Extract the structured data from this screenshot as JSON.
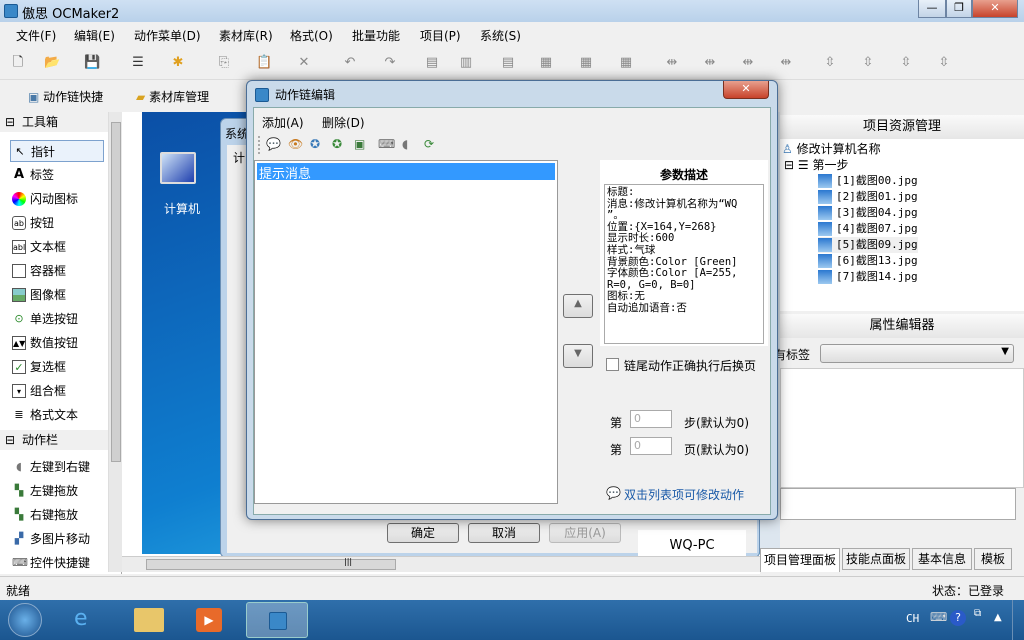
{
  "app": {
    "title": "傲思 OCMaker2"
  },
  "menu": [
    "文件(F)",
    "编辑(E)",
    "动作菜单(D)",
    "素材库(R)",
    "格式(O)",
    "批量功能",
    "项目(P)",
    "系统(S)"
  ],
  "quickbar": {
    "action_chain": "动作链快捷",
    "library": "素材库管理"
  },
  "toolbox": {
    "header": "工具箱",
    "items": [
      "指针",
      "标签",
      "闪动图标",
      "按钮",
      "文本框",
      "容器框",
      "图像框",
      "单选按钮",
      "数值按钮",
      "复选框",
      "组合框",
      "格式文本"
    ],
    "actions_header": "动作栏",
    "actions": [
      "左键到右键",
      "左键拖放",
      "右键拖放",
      "多图片移动",
      "控件快捷键"
    ]
  },
  "desktop": {
    "icon_label": "计算机",
    "window_title": "系统",
    "tab": "计",
    "ok": "确定",
    "cancel": "取消",
    "apply": "应用(A)",
    "computer_name": "WQ-PC"
  },
  "resource": {
    "header": "项目资源管理",
    "root": "修改计算机名称",
    "step": "第一步",
    "files": [
      "[1]截图00.jpg",
      "[2]截图01.jpg",
      "[3]截图04.jpg",
      "[4]截图07.jpg",
      "[5]截图09.jpg",
      "[6]截图13.jpg",
      "[7]截图14.jpg"
    ]
  },
  "props": {
    "header": "属性编辑器",
    "label": "有标签",
    "value": ""
  },
  "tabs": [
    "项目管理面板",
    "技能点面板",
    "基本信息",
    "模板"
  ],
  "status": {
    "left": "就绪",
    "right": "状态：已登录"
  },
  "tray": {
    "lang": "CH"
  },
  "dialog": {
    "title": "动作链编辑",
    "menu_add": "添加(A)",
    "menu_delete": "删除(D)",
    "list": [
      "提示消息"
    ],
    "param_title": "参数描述",
    "params": [
      "标题:",
      "消息:修改计算机名称为“WQ",
      "”。",
      "位置:{X=164,Y=268}",
      "显示时长:600",
      "样式:气球",
      "背景颜色:Color [Green]",
      "字体颜色:Color [A=255,",
      "R=0, G=0, B=0]",
      "图标:无",
      "自动追加语音:否"
    ],
    "checkbox": "链尾动作正确执行后换页",
    "checkbox_checked": false,
    "step_prefix": "第",
    "step_value": "0",
    "step_suffix": "步(默认为0)",
    "page_prefix": "第",
    "page_value": "0",
    "page_suffix": "页(默认为0)",
    "hint": "双击列表项可修改动作"
  }
}
